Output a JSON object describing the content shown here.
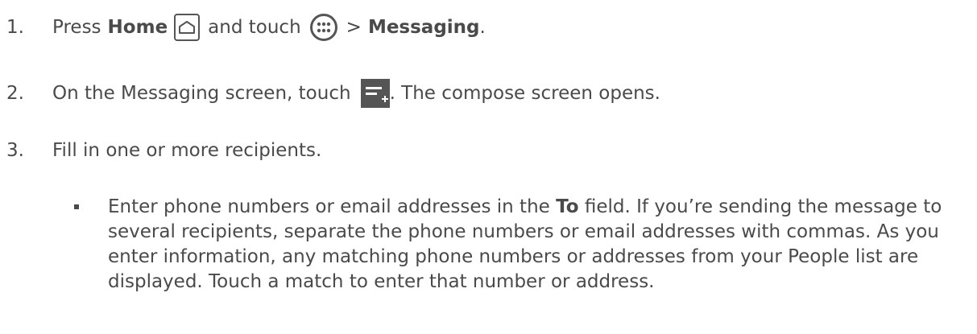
{
  "steps": [
    {
      "number": "1.",
      "text_a": "Press",
      "bold_a": "Home",
      "icon_a": "home-icon",
      "text_b": "and touch",
      "icon_b": "apps-icon",
      "text_c": ">",
      "bold_c": "Messaging",
      "text_d": "."
    },
    {
      "number": "2.",
      "text_a": "On the Messaging screen, touch",
      "icon_a": "compose-icon",
      "text_b": ". The compose screen opens."
    },
    {
      "number": "3.",
      "text_a": "Fill in one or more recipients."
    }
  ],
  "bullet": {
    "text_a": "Enter phone numbers or email addresses in the",
    "bold_a": "To",
    "text_b": "field. If you’re sending the message to several recipients, separate the phone numbers or email addresses with commas. As you enter information, any matching phone numbers or addresses from your People list are displayed. Touch a match to enter that number or address."
  },
  "colors": {
    "text": "#4a4a4a",
    "icon": "#555555"
  }
}
